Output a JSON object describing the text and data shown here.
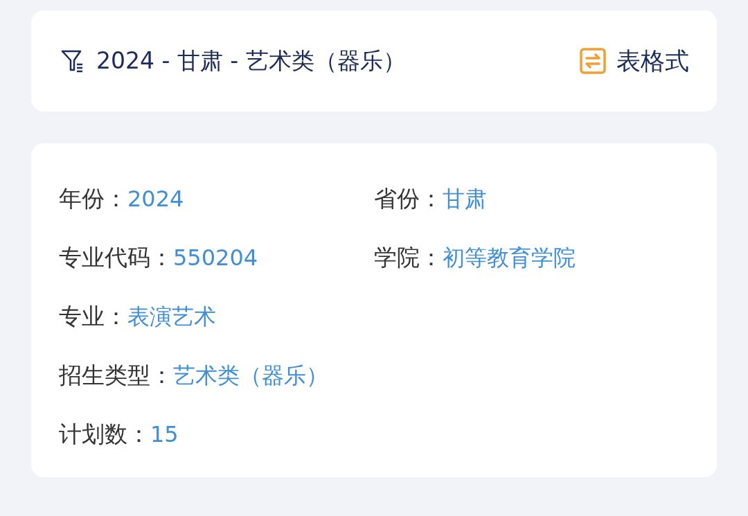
{
  "filter_bar": {
    "summary": "2024 - 甘肃 - 艺术类（器乐）",
    "view_toggle": "表格式"
  },
  "details": {
    "rows": [
      [
        {
          "label": "年份：",
          "value": "2024"
        },
        {
          "label": "省份：",
          "value": "甘肃"
        }
      ],
      [
        {
          "label": "专业代码：",
          "value": "550204"
        },
        {
          "label": "学院：",
          "value": "初等教育学院"
        }
      ],
      [
        {
          "label": "专业：",
          "value": "表演艺术"
        }
      ],
      [
        {
          "label": "招生类型：",
          "value": "艺术类（器乐）"
        }
      ],
      [
        {
          "label": "计划数：",
          "value": "15"
        }
      ]
    ]
  }
}
